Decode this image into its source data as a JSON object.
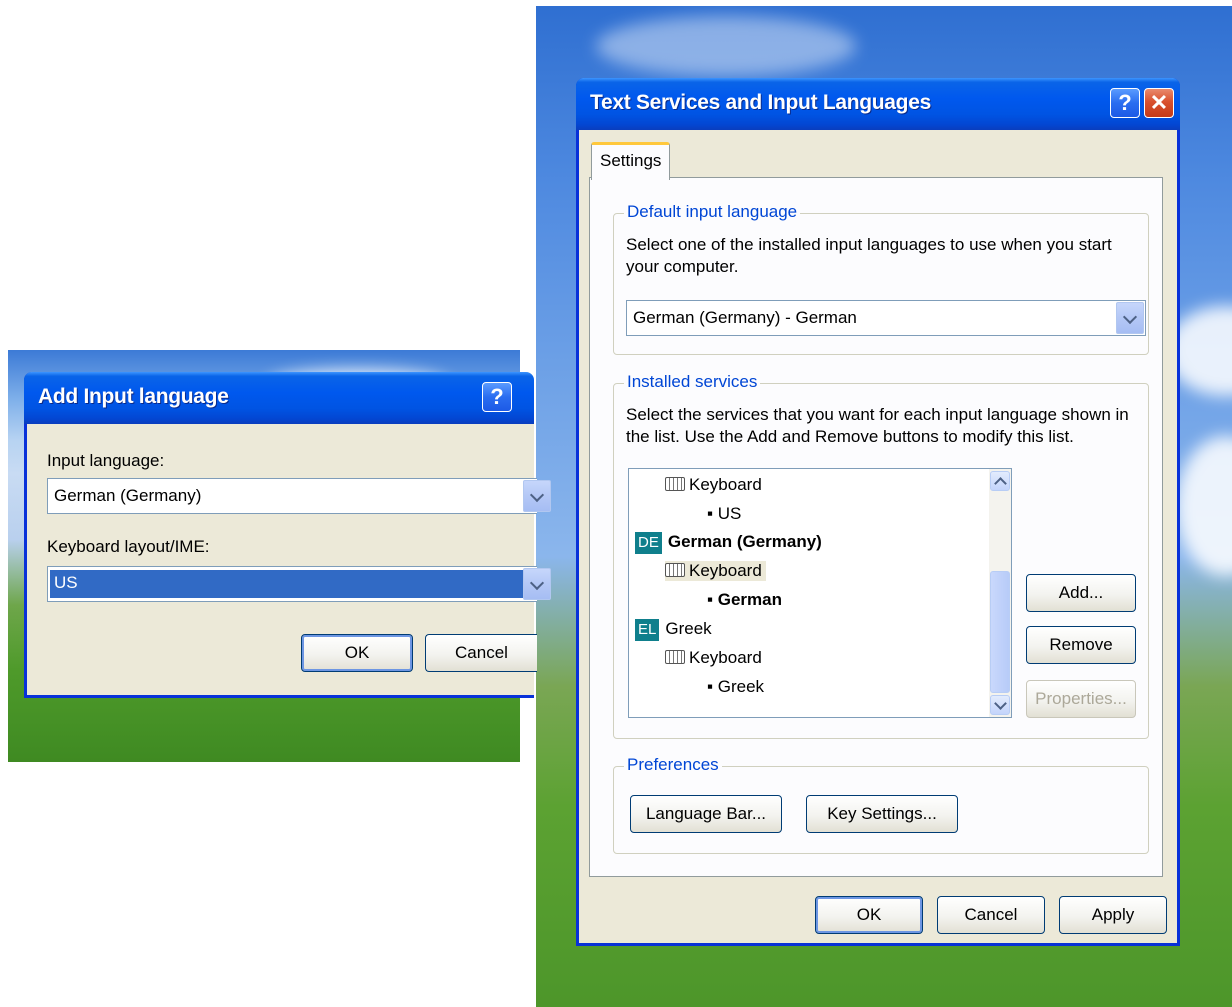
{
  "add_dialog": {
    "title": "Add Input language",
    "help_button": "?",
    "input_language_label": "Input language:",
    "input_language_value": "German (Germany)",
    "keyboard_layout_label": "Keyboard layout/IME:",
    "keyboard_layout_value": "US",
    "ok_label": "OK",
    "cancel_label": "Cancel"
  },
  "main_dialog": {
    "title": "Text Services and Input Languages",
    "help_button": "?",
    "close_button": "✕",
    "tab_settings": "Settings",
    "default_group": {
      "title": "Default input language",
      "description": "Select one of the installed input languages to use when you start your computer.",
      "selected": "German (Germany) - German"
    },
    "installed_group": {
      "title": "Installed services",
      "description": "Select the services that you want for each input language shown in the list. Use the Add and Remove buttons to modify this list.",
      "tree": {
        "kb1": "Keyboard",
        "layout_us": "US",
        "de_badge": "DE",
        "german_lang": "German (Germany)",
        "kb2": "Keyboard",
        "layout_german": "German",
        "el_badge": "EL",
        "greek_lang": "Greek",
        "kb3": "Keyboard",
        "layout_greek": "Greek"
      },
      "add_label": "Add...",
      "remove_label": "Remove",
      "properties_label": "Properties..."
    },
    "preferences_group": {
      "title": "Preferences",
      "language_bar_label": "Language Bar...",
      "key_settings_label": "Key Settings..."
    },
    "ok_label": "OK",
    "cancel_label": "Cancel",
    "apply_label": "Apply"
  },
  "colors": {
    "titlebar": "#0054e3",
    "window_bg": "#ece9d8",
    "group_title": "#0046d5",
    "selection": "#316ac5",
    "lang_badge": "#0f7f8c"
  }
}
